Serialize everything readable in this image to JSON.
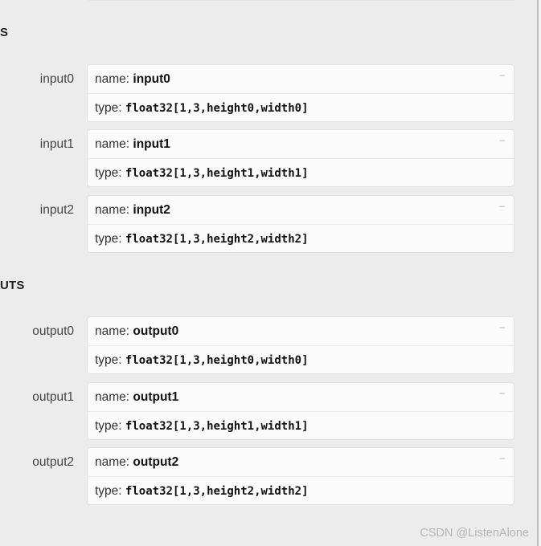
{
  "sections": {
    "inputs": {
      "title": "S",
      "rows": [
        {
          "label": "input0",
          "name_prefix": "name: ",
          "name": "input0",
          "type_prefix": "type: ",
          "type": "float32[1,3,height0,width0]",
          "toggle": "–"
        },
        {
          "label": "input1",
          "name_prefix": "name: ",
          "name": "input1",
          "type_prefix": "type: ",
          "type": "float32[1,3,height1,width1]",
          "toggle": "–"
        },
        {
          "label": "input2",
          "name_prefix": "name: ",
          "name": "input2",
          "type_prefix": "type: ",
          "type": "float32[1,3,height2,width2]",
          "toggle": "–"
        }
      ]
    },
    "outputs": {
      "title": "UTS",
      "rows": [
        {
          "label": "output0",
          "name_prefix": "name: ",
          "name": "output0",
          "type_prefix": "type: ",
          "type": "float32[1,3,height0,width0]",
          "toggle": "–"
        },
        {
          "label": "output1",
          "name_prefix": "name: ",
          "name": "output1",
          "type_prefix": "type: ",
          "type": "float32[1,3,height1,width1]",
          "toggle": "–"
        },
        {
          "label": "output2",
          "name_prefix": "name: ",
          "name": "output2",
          "type_prefix": "type: ",
          "type": "float32[1,3,height2,width2]",
          "toggle": "–"
        }
      ]
    }
  },
  "watermark": "CSDN @ListenAlone"
}
